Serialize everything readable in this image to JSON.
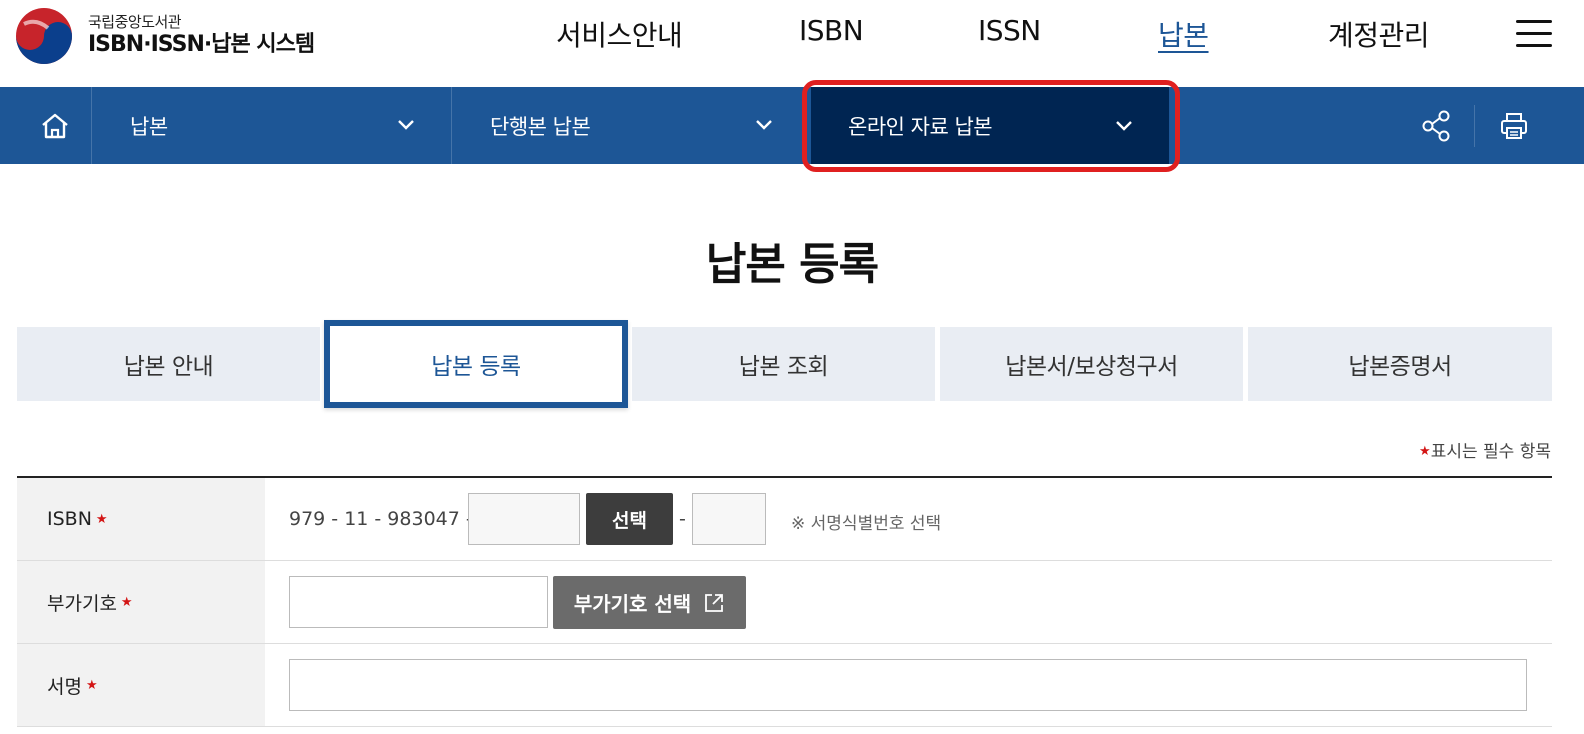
{
  "header": {
    "logo_sub": "국립중앙도서관",
    "logo_main": "ISBN·ISSN·납본 시스템",
    "nav": [
      {
        "label": "서비스안내"
      },
      {
        "label": "ISBN"
      },
      {
        "label": "ISSN"
      },
      {
        "label": "납본",
        "active": true
      },
      {
        "label": "계정관리"
      }
    ]
  },
  "locbar": {
    "level1": "납본",
    "level2": "단행본 납본",
    "level3": "온라인 자료 납본"
  },
  "page": {
    "title": "납본 등록"
  },
  "tabs": [
    {
      "label": "납본 안내"
    },
    {
      "label": "납본 등록",
      "active": true
    },
    {
      "label": "납본 조회"
    },
    {
      "label": "납본서/보상청구서"
    },
    {
      "label": "납본증명서"
    }
  ],
  "required_note": "표시는 필수 항목",
  "form": {
    "isbn": {
      "label": "ISBN",
      "prefix": "979 - 11 - 983047 -",
      "select_button": "선택",
      "dash": "-",
      "hint": "※ 서명식별번호 선택"
    },
    "addl": {
      "label": "부가기호",
      "select_button": "부가기호 선택"
    },
    "title": {
      "label": "서명"
    }
  },
  "colors": {
    "primary": "#1d5696",
    "current_nav": "#002552",
    "highlight": "#e02020",
    "required": "#d31515"
  }
}
